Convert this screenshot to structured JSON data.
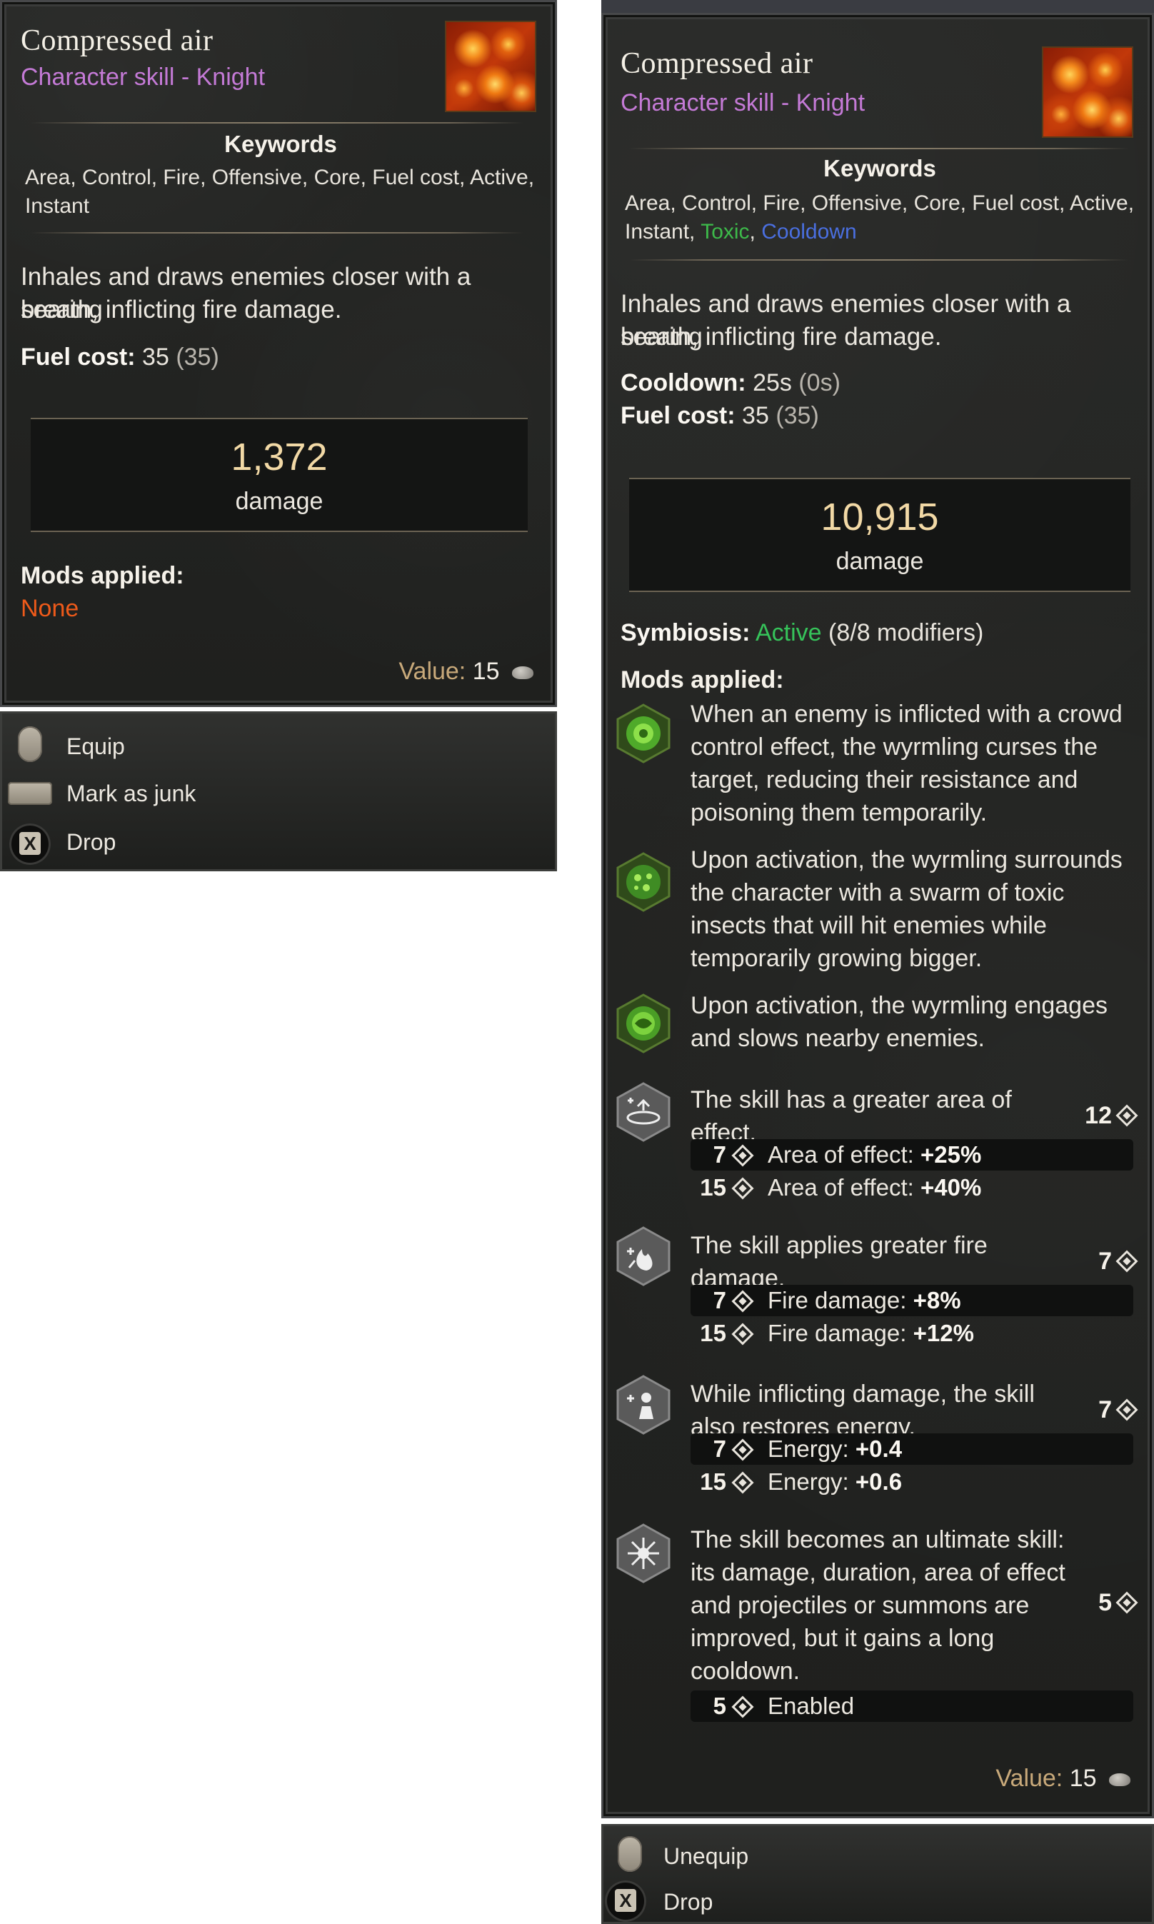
{
  "left_card": {
    "title": "Compressed air",
    "subtitle": "Character skill - Knight",
    "keywords_heading": "Keywords",
    "keywords_line1": "Area, Control, Fire, Offensive, Core, Fuel cost, Active,",
    "keywords_line2": "Instant",
    "description_line1": "Inhales and draws enemies closer with a searing",
    "description_line2": "breath, inflicting fire damage.",
    "fuel_cost_label": "Fuel cost:",
    "fuel_cost_value": "35",
    "fuel_cost_base": "(35)",
    "damage_value": "1,372",
    "damage_label": "damage",
    "mods_heading": "Mods applied:",
    "mods_none": "None",
    "value_label": "Value:",
    "value_amount": "15",
    "actions": [
      {
        "label": "Equip",
        "icon": "mouse-icon"
      },
      {
        "label": "Mark as junk",
        "icon": "spacebar-key-icon"
      },
      {
        "label": "Drop",
        "icon": "x-key-icon"
      }
    ]
  },
  "right_card": {
    "title": "Compressed air",
    "subtitle": "Character skill - Knight",
    "keywords_heading": "Keywords",
    "keywords_line1": "Area, Control, Fire, Offensive, Core, Fuel cost, Active,",
    "keywords_line2_plain": "Instant, ",
    "keyword_toxic": "Toxic",
    "keyword_sep": ", ",
    "keyword_cooldown": "Cooldown",
    "description_line1": "Inhales and draws enemies closer with a searing",
    "description_line2": "breath, inflicting fire damage.",
    "cooldown_label": "Cooldown:",
    "cooldown_value": "25s",
    "cooldown_base": "(0s)",
    "fuel_cost_label": "Fuel cost:",
    "fuel_cost_value": "35",
    "fuel_cost_base": "(35)",
    "damage_value": "10,915",
    "damage_label": "damage",
    "symbiosis_label": "Symbiosis:",
    "symbiosis_status": "Active",
    "symbiosis_count": "(8/8 modifiers)",
    "mods_heading": "Mods applied:",
    "mods": [
      {
        "icon": "toxic-curse-icon",
        "lines": [
          "When an enemy is inflicted with a crowd",
          "control effect, the wyrmling curses the",
          "target, reducing their resistance and",
          "poisoning them temporarily."
        ]
      },
      {
        "icon": "insect-swarm-icon",
        "lines": [
          "Upon activation, the wyrmling surrounds",
          "the character with a swarm of toxic",
          "insects that will hit enemies while",
          "temporarily growing bigger."
        ]
      },
      {
        "icon": "wyrmling-slow-icon",
        "lines": [
          "Upon activation, the wyrmling engages",
          "and slows nearby enemies."
        ]
      },
      {
        "icon": "area-of-effect-icon",
        "lines": [
          "The skill has a greater area of",
          "effect."
        ],
        "rank": "12",
        "tiers": [
          {
            "num": "7",
            "label": "Area of effect:",
            "value": "+25%"
          },
          {
            "num": "15",
            "label": "Area of effect:",
            "value": "+40%"
          }
        ]
      },
      {
        "icon": "fire-damage-icon",
        "lines": [
          "The skill applies greater fire",
          "damage."
        ],
        "rank": "7",
        "tiers": [
          {
            "num": "7",
            "label": "Fire damage:",
            "value": "+8%"
          },
          {
            "num": "15",
            "label": "Fire damage:",
            "value": "+12%"
          }
        ]
      },
      {
        "icon": "energy-restore-icon",
        "lines": [
          "While inflicting damage, the skill",
          "also restores energy."
        ],
        "rank": "7",
        "tiers": [
          {
            "num": "7",
            "label": "Energy:",
            "value": "+0.4"
          },
          {
            "num": "15",
            "label": "Energy:",
            "value": "+0.6"
          }
        ]
      },
      {
        "icon": "ultimate-skill-icon",
        "lines": [
          "The skill becomes an ultimate skill:",
          "its damage, duration, area of effect",
          "and projectiles or summons are",
          "improved, but it gains a long",
          "cooldown."
        ],
        "rank": "5",
        "tiers": [
          {
            "num": "5",
            "label": "Enabled",
            "value": ""
          }
        ]
      }
    ],
    "value_label": "Value:",
    "value_amount": "15",
    "actions": [
      {
        "label": "Unequip",
        "icon": "mouse-icon"
      },
      {
        "label": "Drop",
        "icon": "x-key-icon"
      }
    ]
  }
}
